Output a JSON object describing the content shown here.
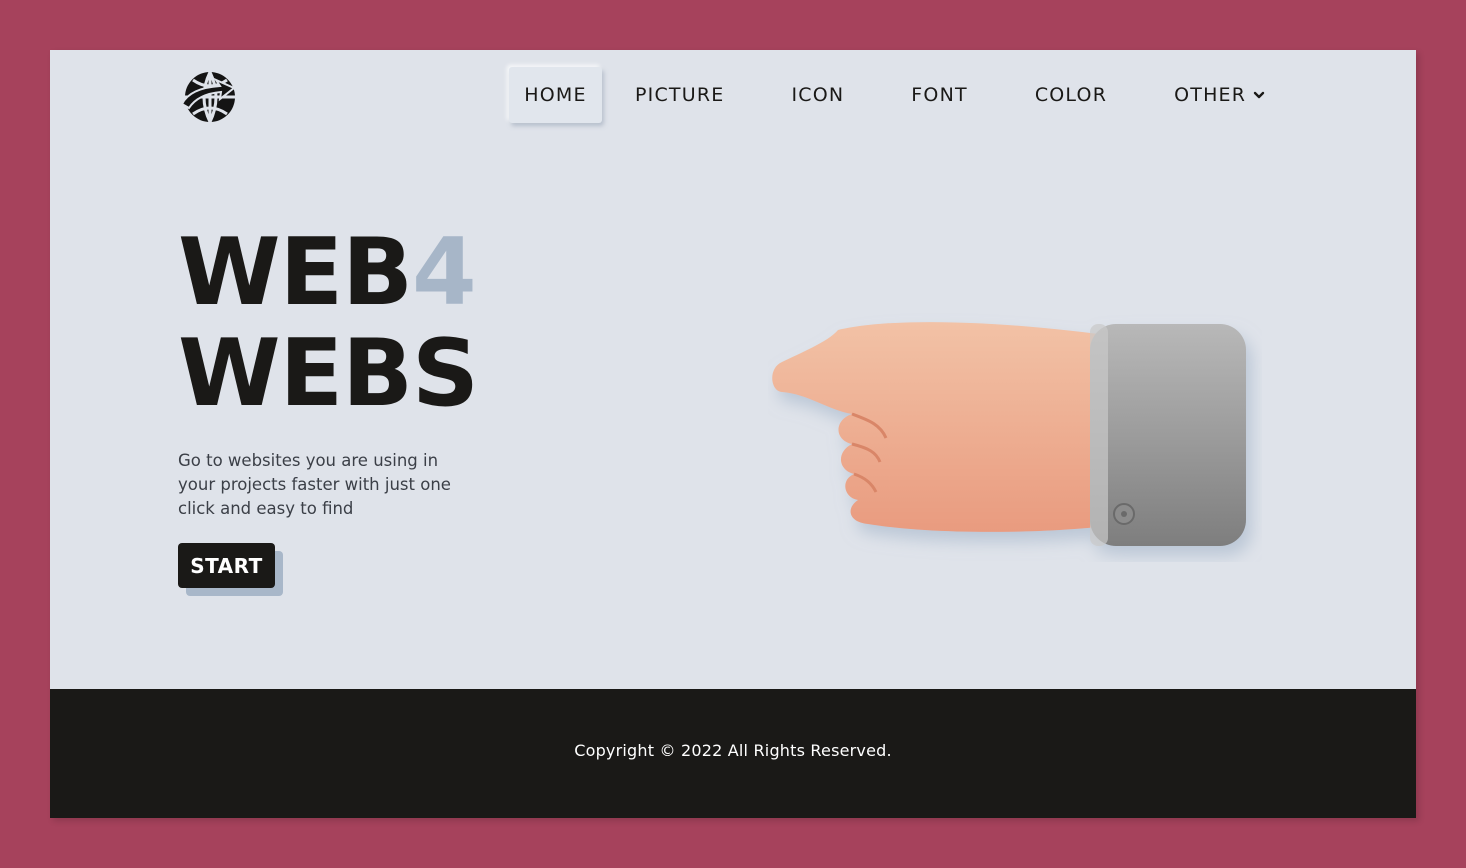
{
  "header": {
    "logo_icon": "globe-arrow-logo",
    "nav": [
      {
        "label": "HOME",
        "active": true
      },
      {
        "label": "PICTURE",
        "active": false
      },
      {
        "label": "ICON",
        "active": false
      },
      {
        "label": "FONT",
        "active": false
      },
      {
        "label": "COLOR",
        "active": false
      },
      {
        "label": "OTHER",
        "active": false,
        "icon": "chevron-down-icon"
      }
    ]
  },
  "hero": {
    "title_part1": "WEB",
    "title_accent": "4",
    "title_line2": "WEBS",
    "description": "Go to websites you are using in your projects faster with just one click and easy to find",
    "start_label": "START",
    "illustration_icon": "pointing-hand-illustration"
  },
  "footer": {
    "copyright": "Copyright © 2022 All Rights Reserved."
  },
  "colors": {
    "page_background": "#a6425c",
    "content_background": "#dfe3ea",
    "text_dark": "#1a1917",
    "accent": "#a7b6c8",
    "footer_background": "#1a1917"
  }
}
